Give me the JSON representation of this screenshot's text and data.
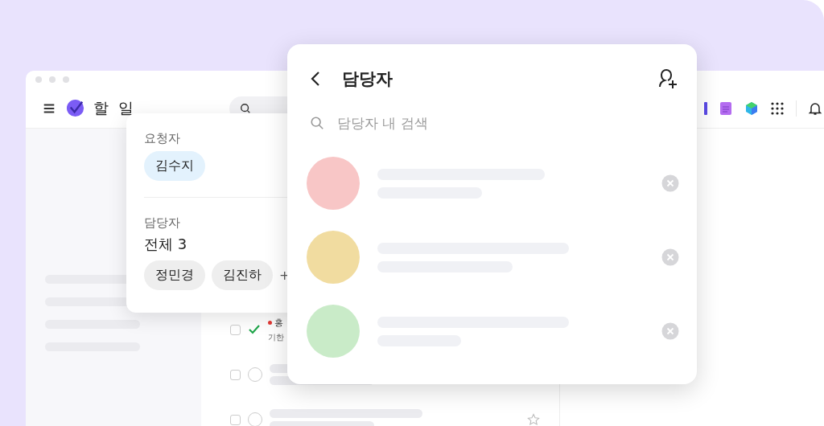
{
  "app": {
    "title": "할 일"
  },
  "tasks": [
    {
      "title": "홍",
      "due": "기한",
      "selected": false,
      "done": true,
      "flagged": true
    },
    {
      "selected": false,
      "done": false,
      "flagged": false
    },
    {
      "selected": false,
      "done": false,
      "flagged": false
    }
  ],
  "requester_card": {
    "requester_label": "요청자",
    "requester": "김수지",
    "assignee_label": "담당자",
    "assignee_count": "전체 3",
    "assignees": [
      "정민경",
      "김진하"
    ],
    "more": "+"
  },
  "assignee_panel": {
    "title": "담당자",
    "search": {
      "placeholder": "담당자 내 검색"
    },
    "assignees": [
      {
        "color": "#f8c6c6"
      },
      {
        "color": "#f1dca0"
      },
      {
        "color": "#c9ebc8"
      }
    ]
  }
}
